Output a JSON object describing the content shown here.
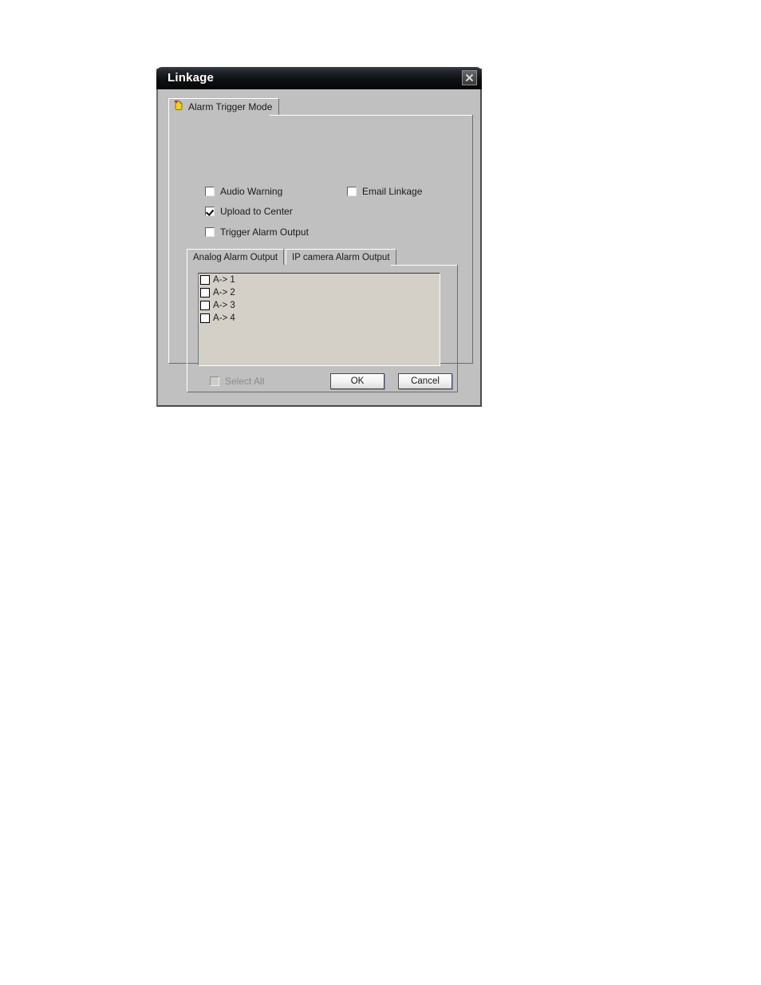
{
  "dialog": {
    "title": "Linkage",
    "close_icon": "close-icon",
    "accent_titlebar": "#0e1113",
    "surface": "#c0c0c0",
    "listbox_bg": "#d4d0c8"
  },
  "outer_tabs": [
    {
      "label": "Alarm Trigger Mode",
      "icon": "alarm-hand-icon",
      "active": true
    }
  ],
  "options": [
    {
      "label": "Audio Warning",
      "checked": false
    },
    {
      "label": "Email Linkage",
      "checked": false
    },
    {
      "label": "Upload to Center",
      "checked": true
    },
    {
      "label": "Trigger Alarm Output",
      "checked": false
    }
  ],
  "inner_tabs": [
    {
      "label": "Analog Alarm Output",
      "active": true
    },
    {
      "label": "IP camera Alarm Output",
      "active": false
    }
  ],
  "alarm_outputs": [
    {
      "label": "A-> 1",
      "checked": false
    },
    {
      "label": "A-> 2",
      "checked": false
    },
    {
      "label": "A-> 3",
      "checked": false
    },
    {
      "label": "A-> 4",
      "checked": false
    }
  ],
  "select_all": {
    "label": "Select All",
    "checked": false,
    "disabled": true
  },
  "footer": {
    "ok_label": "OK",
    "cancel_label": "Cancel"
  }
}
